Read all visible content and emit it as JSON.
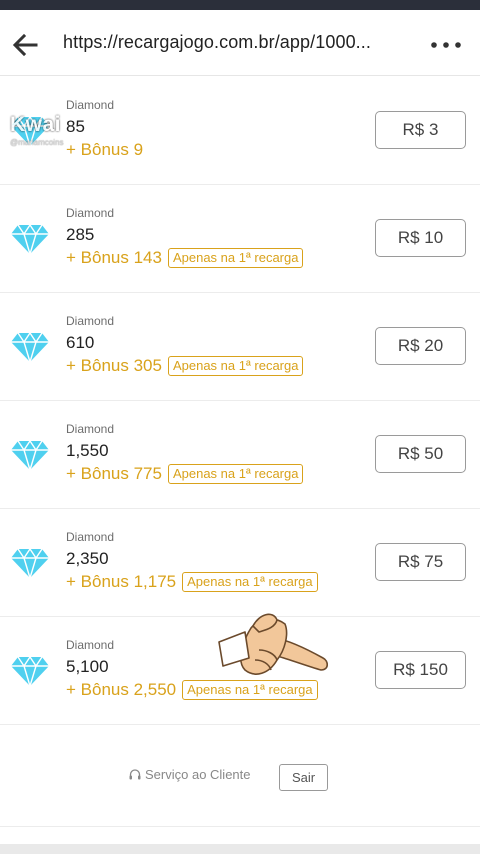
{
  "browser": {
    "url": "https://recargajogo.com.br/app/1000..."
  },
  "packages": [
    {
      "label": "Diamond",
      "amount": "85",
      "bonus": "+ Bônus 9",
      "badge": "",
      "price": "R$ 3"
    },
    {
      "label": "Diamond",
      "amount": "285",
      "bonus": "+ Bônus 143",
      "badge": "Apenas na 1ª recarga",
      "price": "R$ 10"
    },
    {
      "label": "Diamond",
      "amount": "610",
      "bonus": "+ Bônus 305",
      "badge": "Apenas na 1ª recarga",
      "price": "R$ 20"
    },
    {
      "label": "Diamond",
      "amount": "1,550",
      "bonus": "+ Bônus 775",
      "badge": "Apenas na 1ª recarga",
      "price": "R$ 50"
    },
    {
      "label": "Diamond",
      "amount": "2,350",
      "bonus": "+ Bônus 1,175",
      "badge": "Apenas na 1ª recarga",
      "price": "R$ 75"
    },
    {
      "label": "Diamond",
      "amount": "5,100",
      "bonus": "+ Bônus 2,550",
      "badge": "Apenas na 1ª recarga",
      "price": "R$ 150"
    }
  ],
  "footer": {
    "service": "Serviço ao Cliente",
    "logout": "Sair"
  },
  "watermark": {
    "logo": "Kwai",
    "handle": "@mariamcoins"
  },
  "icons": {
    "back": "arrow-left-icon",
    "more": "more-dots-icon",
    "gem": "diamond-icon",
    "headset": "headset-icon",
    "pointer": "pointing-hand-icon"
  },
  "colors": {
    "bonus": "#d9a21b",
    "gem": "#4fd0ef",
    "border": "#9a9a9a"
  }
}
